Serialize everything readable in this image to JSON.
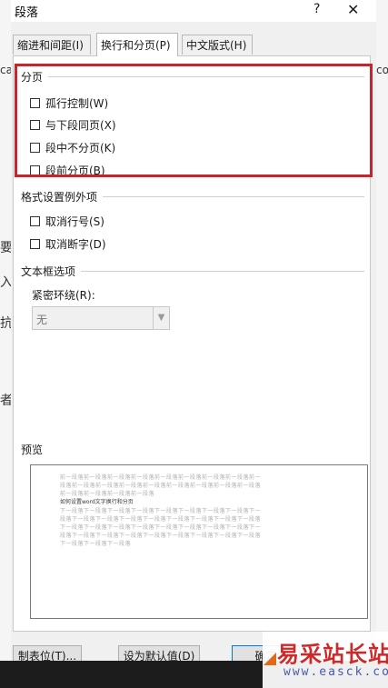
{
  "dialog": {
    "title": "段落",
    "help": "?",
    "close": "✕"
  },
  "tabs": [
    {
      "label": "缩进和间距(I)"
    },
    {
      "label": "换行和分页(P)",
      "active": true
    },
    {
      "label": "中文版式(H)"
    }
  ],
  "pagination": {
    "title": "分页",
    "options": [
      {
        "label": "孤行控制(W)",
        "checked": false
      },
      {
        "label": "与下段同页(X)",
        "checked": false
      },
      {
        "label": "段中不分页(K)",
        "checked": false
      },
      {
        "label": "段前分页(B)",
        "checked": false
      }
    ]
  },
  "format_exceptions": {
    "title": "格式设置例外项",
    "options": [
      {
        "label": "取消行号(S)",
        "checked": false
      },
      {
        "label": "取消断字(D)",
        "checked": false
      }
    ]
  },
  "textbox": {
    "title": "文本框选项",
    "wrap_label": "紧密环绕(R):",
    "wrap_value": "无"
  },
  "preview": {
    "title": "预览",
    "prev_lines": [
      "前一段落前一段落前一段落前一段落前一段落前一段落前一段落前一段落前一",
      "段落前一段落前一段落前一段落前一段落前一段落前一段落前一段落前一段落",
      "前一段落前一段落前一段落前一段落"
    ],
    "sample": "如何设置word文字换行和分页",
    "next_lines": [
      "下一段落下一段落下一段落下一段落下一段落下一段落下一段落下一段落下一",
      "段落下一段落下一段落下一段落下一段落下一段落下一段落下一段落下一段落",
      "下一段落下一段落下一段落下一段落下一段落下一段落下一段落下一段落下一",
      "段落下一段落下一段落下一段落下一段落下一段落下一段落下一段落下一段落",
      "下一段落下一段落下一段落"
    ]
  },
  "buttons": {
    "tabs": "制表位(T)...",
    "default": "设为默认值(D)",
    "ok": "确定"
  },
  "background_fragments": [
    "要",
    "入",
    "抗",
    "者",
    "ca",
    "co"
  ],
  "watermark": {
    "text": "易采站长站",
    "url": "www.easck.com"
  },
  "colors": {
    "highlight_border": "#c4262e",
    "dialog_bg": "#f0f0f0",
    "watermark_red": "#cc2a2a",
    "watermark_blue": "#4a5aa8"
  }
}
